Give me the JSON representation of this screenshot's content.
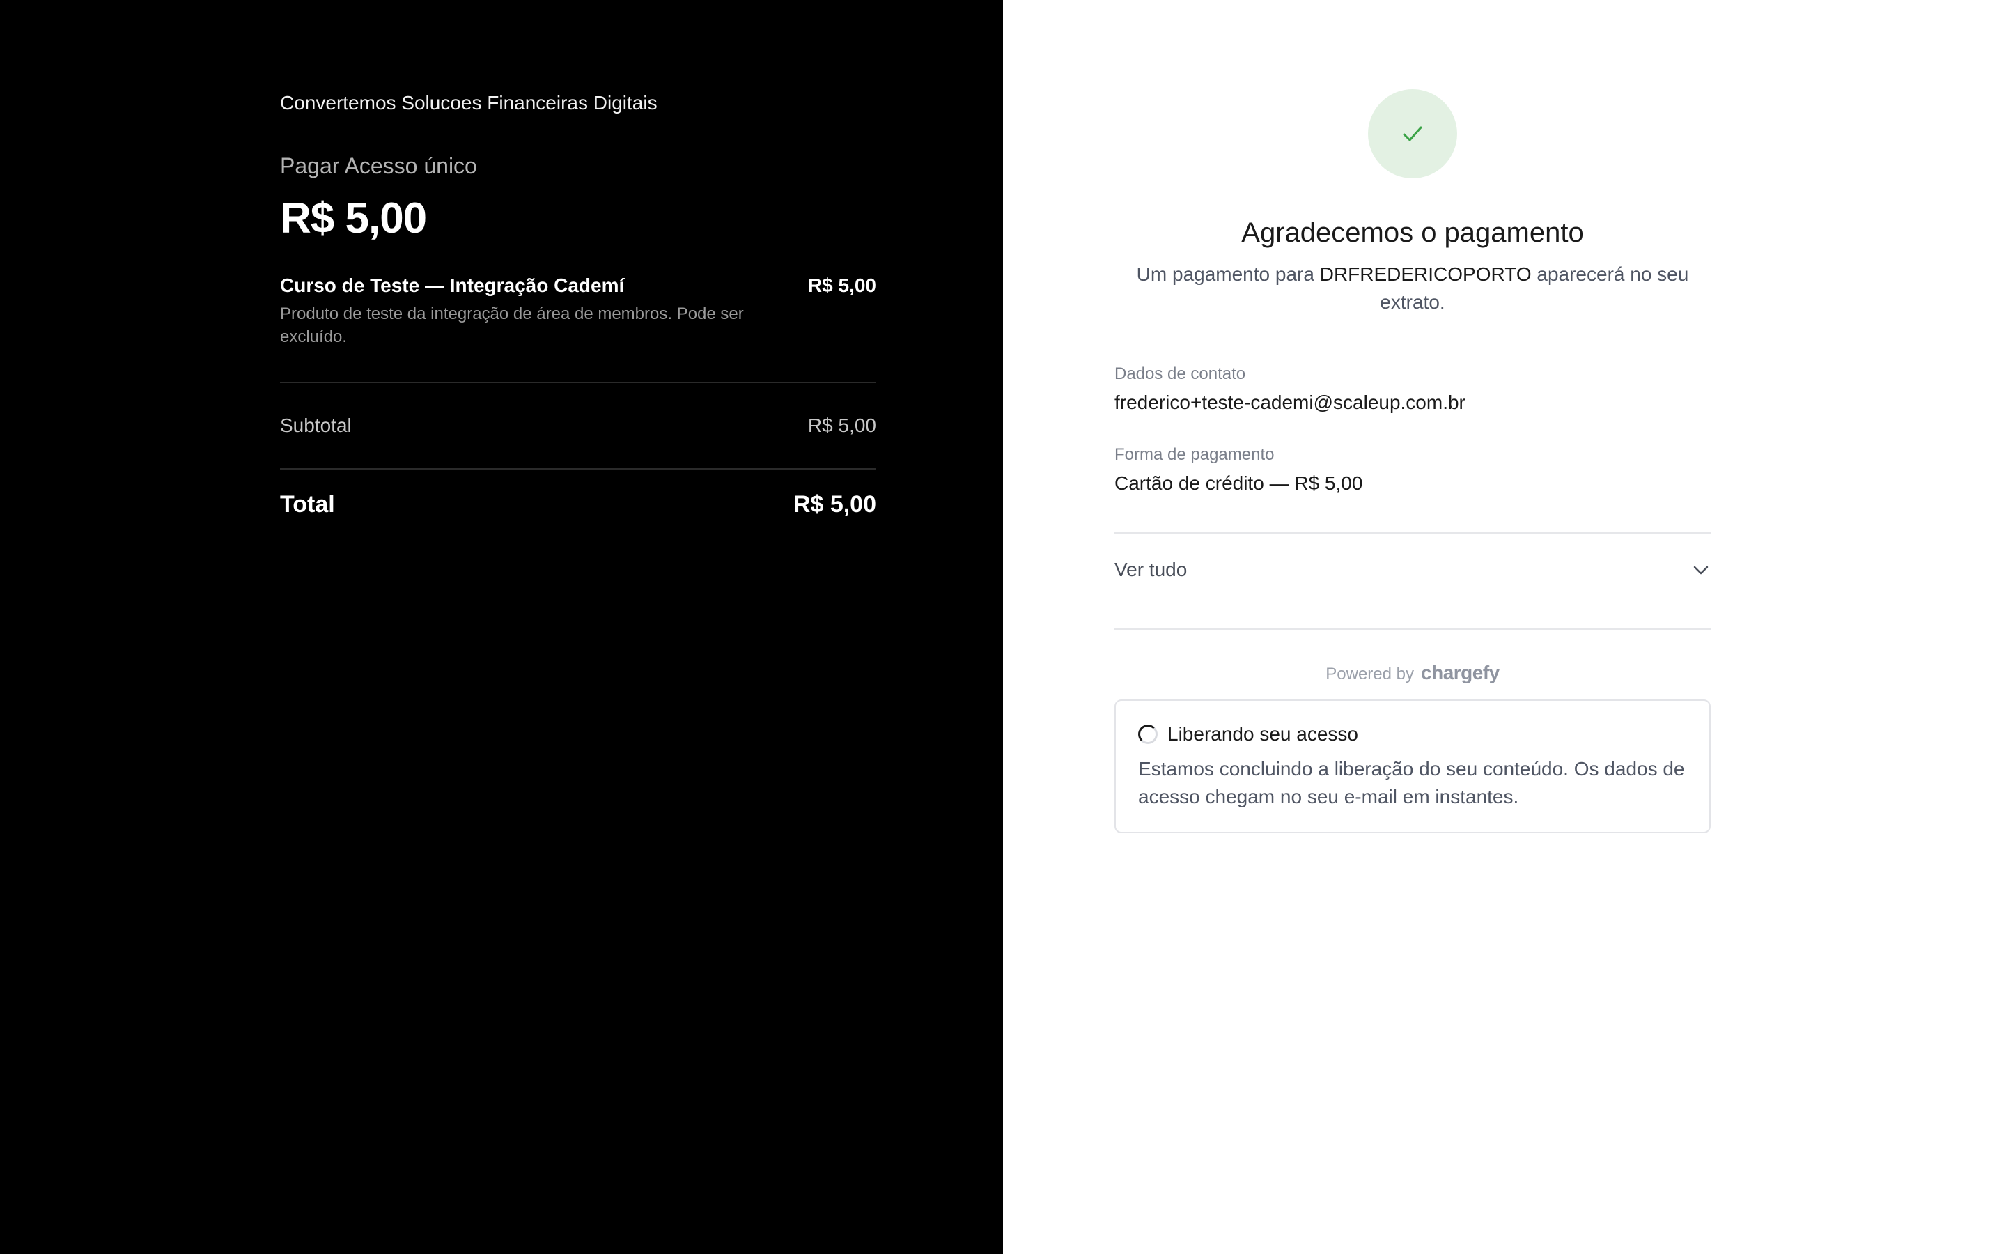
{
  "summary": {
    "merchant": "Convertemos Solucoes Financeiras Digitais",
    "product_title": "Pagar Acesso único",
    "amount": "R$ 5,00",
    "item": {
      "name": "Curso de Teste — Integração Cademí",
      "description": "Produto de teste da integração de área de membros. Pode ser excluído.",
      "price": "R$ 5,00"
    },
    "subtotal_label": "Subtotal",
    "subtotal_value": "R$ 5,00",
    "total_label": "Total",
    "total_value": "R$ 5,00"
  },
  "confirmation": {
    "icon": "check-icon",
    "title": "Agradecemos o pagamento",
    "statement_prefix": "Um pagamento para",
    "statement_merchant": "DRFREDERICOPORTO",
    "statement_suffix": "aparecerá no seu extrato.",
    "contact_label": "Dados de contato",
    "contact_value": "frederico+teste-cademi@scaleup.com.br",
    "payment_label": "Forma de pagamento",
    "payment_value": "Cartão de crédito — R$ 5,00",
    "see_all": "Ver tudo",
    "powered_by": "Powered by",
    "brand": "chargefy",
    "notice_title": "Liberando seu acesso",
    "notice_body": "Estamos concluindo a liberação do seu conteúdo. Os dados de acesso chegam no seu e-mail em instantes."
  },
  "colors": {
    "left_bg": "#000000",
    "success_bg": "#e3f1e3",
    "success_check": "#3aa346"
  }
}
